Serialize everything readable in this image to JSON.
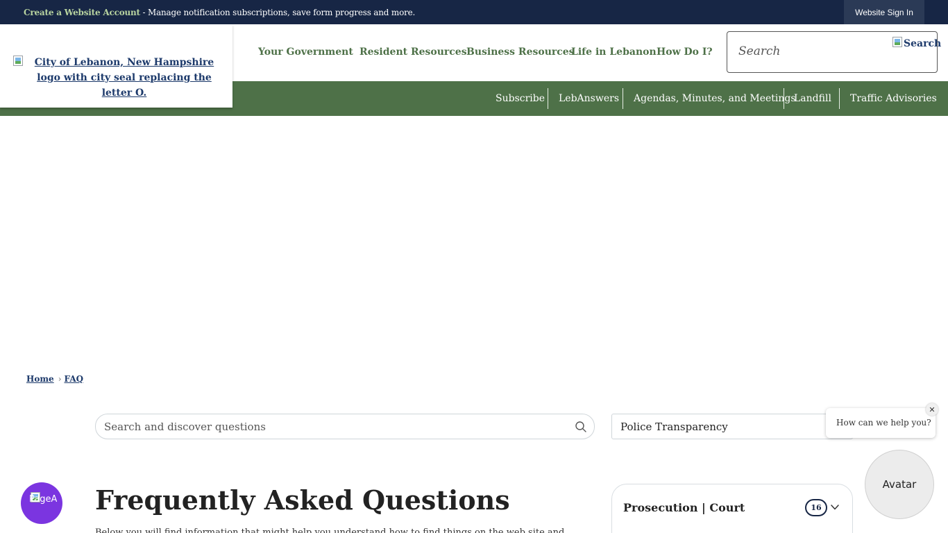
{
  "topbar": {
    "create_account_link": "Create a Website Account",
    "create_account_desc": " - Manage notification subscriptions, save form progress and more.",
    "sign_in_button": "Website Sign In"
  },
  "logo": {
    "alt_text": "City of Lebanon, New Hampshire logo with city seal replacing the letter O."
  },
  "main_nav": {
    "items": [
      "Your Government",
      "Resident Resources",
      "Business Resources",
      "Life in Lebanon",
      "How Do I?"
    ]
  },
  "site_search": {
    "placeholder": "Search",
    "button_alt": "Search"
  },
  "quick_links": {
    "items": [
      "Subscribe",
      "LebAnswers",
      "Agendas, Minutes, and Meetings",
      "Landfill",
      "Traffic Advisories"
    ]
  },
  "breadcrumb": {
    "home": "Home",
    "separator": "›",
    "current": "FAQ"
  },
  "faq_search": {
    "placeholder": "Search and discover questions",
    "category_selected": "Police Transparency"
  },
  "page": {
    "title": "Frequently Asked Questions",
    "intro": "Below you will find information that might help you understand how to find things on the web site and ..."
  },
  "category_card": {
    "title": "Prosecution | Court",
    "count": "16"
  },
  "chat": {
    "prompt": "How can we help you?",
    "close": "✕",
    "avatar": "Avatar"
  },
  "accessibility": {
    "label": "PageA Perso"
  },
  "colors": {
    "topbar": "#172645",
    "green": "#4e7148",
    "link_blue": "#1d3a6b",
    "widget_purple": "#7b35e0"
  }
}
